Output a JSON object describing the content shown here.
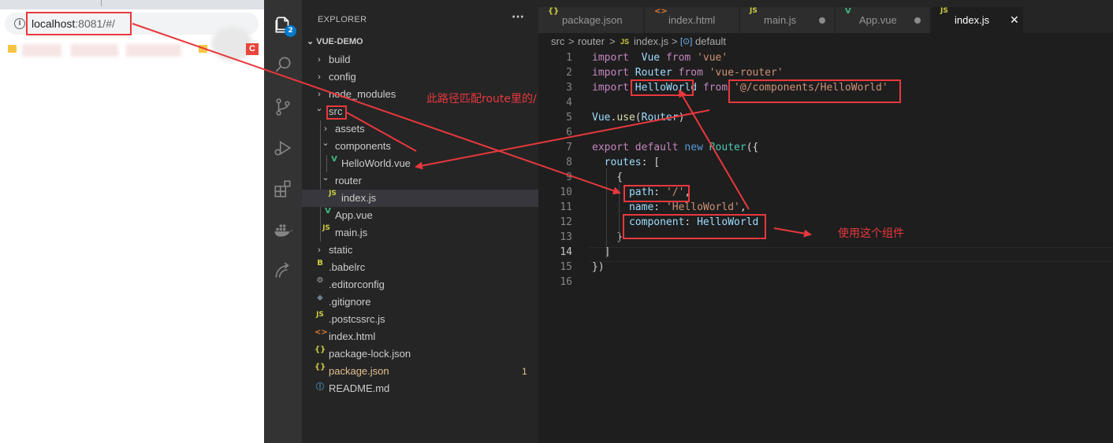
{
  "browser": {
    "url_host": "localhost",
    "url_rest": ":8081/#/",
    "info_icon": "i",
    "bookmark_badge": "C"
  },
  "activity_bar": {
    "items": [
      "explorer-icon",
      "search-icon",
      "source-control-icon",
      "debug-icon",
      "extensions-icon",
      "docker-icon",
      "remote-icon"
    ],
    "explorer_badge": "2"
  },
  "sidebar": {
    "title": "EXPLORER",
    "more": "···",
    "section": "VUE-DEMO",
    "items": [
      {
        "label": "build",
        "chevron": "›",
        "icon": ""
      },
      {
        "label": "config",
        "chevron": "›",
        "icon": ""
      },
      {
        "label": "node_modules",
        "chevron": "›",
        "icon": ""
      },
      {
        "label": "src",
        "chevron": "⌄",
        "icon": ""
      },
      {
        "label": "assets",
        "chevron": "›",
        "icon": ""
      },
      {
        "label": "components",
        "chevron": "⌄",
        "icon": ""
      },
      {
        "label": "HelloWorld.vue",
        "chevron": "",
        "icon": "V"
      },
      {
        "label": "router",
        "chevron": "⌄",
        "icon": ""
      },
      {
        "label": "index.js",
        "chevron": "",
        "icon": "JS"
      },
      {
        "label": "App.vue",
        "chevron": "",
        "icon": "V"
      },
      {
        "label": "main.js",
        "chevron": "",
        "icon": "JS"
      },
      {
        "label": "static",
        "chevron": "›",
        "icon": ""
      },
      {
        "label": ".babelrc",
        "chevron": "",
        "icon": "B"
      },
      {
        "label": ".editorconfig",
        "chevron": "",
        "icon": "⚙"
      },
      {
        "label": ".gitignore",
        "chevron": "",
        "icon": "◆"
      },
      {
        "label": ".postcssrc.js",
        "chevron": "",
        "icon": "JS"
      },
      {
        "label": "index.html",
        "chevron": "",
        "icon": "<>"
      },
      {
        "label": "package-lock.json",
        "chevron": "",
        "icon": "{}"
      },
      {
        "label": "package.json",
        "chevron": "",
        "icon": "{}",
        "decoration": "1"
      },
      {
        "label": "README.md",
        "chevron": "",
        "icon": "ⓘ"
      }
    ]
  },
  "tabs": [
    {
      "label": "package.json",
      "icon": "{}"
    },
    {
      "label": "index.html",
      "icon": "<>"
    },
    {
      "label": "main.js",
      "icon": "JS",
      "dirty": true
    },
    {
      "label": "App.vue",
      "icon": "V",
      "dirty": true
    },
    {
      "label": "index.js",
      "icon": "JS",
      "active": true,
      "close": "✕"
    }
  ],
  "breadcrumbs": {
    "parts": [
      "src",
      ">",
      "router",
      ">",
      "JS",
      "index.js",
      ">",
      "[⊙]",
      "default"
    ]
  },
  "editor": {
    "line_numbers": [
      "1",
      "2",
      "3",
      "4",
      "5",
      "6",
      "7",
      "8",
      "9",
      "10",
      "11",
      "12",
      "13",
      "14",
      "15",
      "16"
    ],
    "current_line": "14",
    "lines": [
      [
        [
          "kw",
          "import"
        ],
        [
          "",
          "  "
        ],
        [
          "var",
          "Vue"
        ],
        [
          "",
          " "
        ],
        [
          "kw",
          "from"
        ],
        [
          "",
          " "
        ],
        [
          "str",
          "'vue'"
        ]
      ],
      [
        [
          "kw",
          "import"
        ],
        [
          "",
          " "
        ],
        [
          "var",
          "Router"
        ],
        [
          "",
          " "
        ],
        [
          "kw",
          "from"
        ],
        [
          "",
          " "
        ],
        [
          "str",
          "'vue-router'"
        ]
      ],
      [
        [
          "kw",
          "import"
        ],
        [
          "",
          " "
        ],
        [
          "var",
          "HelloWorld"
        ],
        [
          "",
          " "
        ],
        [
          "kw",
          "from"
        ],
        [
          "",
          " "
        ],
        [
          "str",
          "'@/components/HelloWorld'"
        ]
      ],
      [],
      [
        [
          "var",
          "Vue"
        ],
        [
          "",
          "."
        ],
        [
          "fn",
          "use"
        ],
        [
          "",
          "("
        ],
        [
          "var",
          "Router"
        ],
        [
          "",
          ")"
        ]
      ],
      [],
      [
        [
          "kw",
          "export"
        ],
        [
          "",
          " "
        ],
        [
          "kw",
          "default"
        ],
        [
          "",
          " "
        ],
        [
          "kw2",
          "new"
        ],
        [
          "",
          " "
        ],
        [
          "cls",
          "Router"
        ],
        [
          "",
          "({"
        ]
      ],
      [
        [
          "",
          "  "
        ],
        [
          "var",
          "routes"
        ],
        [
          "",
          ": ["
        ]
      ],
      [
        [
          "",
          "    {"
        ]
      ],
      [
        [
          "",
          "      "
        ],
        [
          "var",
          "path"
        ],
        [
          "",
          ": "
        ],
        [
          "str",
          "'/'"
        ],
        [
          "",
          ","
        ]
      ],
      [
        [
          "",
          "      "
        ],
        [
          "var",
          "name"
        ],
        [
          "",
          ": "
        ],
        [
          "str",
          "'HelloWorld'"
        ],
        [
          "",
          ","
        ]
      ],
      [
        [
          "",
          "      "
        ],
        [
          "var",
          "component"
        ],
        [
          "",
          ": "
        ],
        [
          "var",
          "HelloWorld"
        ]
      ],
      [
        [
          "",
          "    }"
        ]
      ],
      [
        [
          "",
          "  ]"
        ]
      ],
      [
        [
          "",
          "})"
        ]
      ],
      []
    ]
  },
  "annotations": {
    "route_path_note": "此路径匹配route里的/",
    "use_component_note": "使用这个组件",
    "accent_color": "#e8383d"
  }
}
